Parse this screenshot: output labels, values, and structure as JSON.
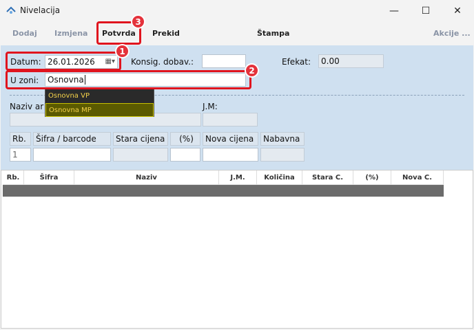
{
  "window": {
    "title": "Nivelacija",
    "controls": {
      "minimize": "—",
      "maximize": "☐",
      "close": "✕"
    }
  },
  "toolbar": {
    "dodaj": "Dodaj",
    "izmjena": "Izmjena",
    "potvrda": "Potvrda",
    "prekid": "Prekid",
    "stampa": "Štampa",
    "akcije": "Akcije ..."
  },
  "form": {
    "datum_label": "Datum:",
    "datum_value": "26.01.2026",
    "konsig_label": "Konsig. dobav.:",
    "konsig_value": "",
    "efekat_label": "Efekat:",
    "efekat_value": "0.00",
    "zona_label": "U zoni:",
    "zona_value": "Osnovna",
    "naziv_label": "Naziv ar",
    "jm_label": "J.M:",
    "rb_label": "Rb.",
    "sifra_label": "Šifra / barcode",
    "stara_label": "Stara cijena",
    "pct_label": "(%)",
    "nova_label": "Nova cijena",
    "nabavna_label": "Nabavna",
    "rb_value": "1"
  },
  "dropdown": {
    "options": [
      "Osnovna VP",
      "Osnovna MP"
    ],
    "highlighted_index": 1
  },
  "grid": {
    "columns": [
      "Rb.",
      "Šifra",
      "Naziv",
      "J.M.",
      "Količina",
      "Stara C.",
      "(%)",
      "Nova C."
    ]
  },
  "annotations": {
    "badge1": "1",
    "badge2": "2",
    "badge3": "3"
  },
  "colors": {
    "highlight_red": "#e0141e",
    "form_bg": "#cfe0f0",
    "dropdown_bg": "#2a2a2a",
    "dropdown_selected": "#5b5a00",
    "dropdown_text": "#f4d24a"
  }
}
